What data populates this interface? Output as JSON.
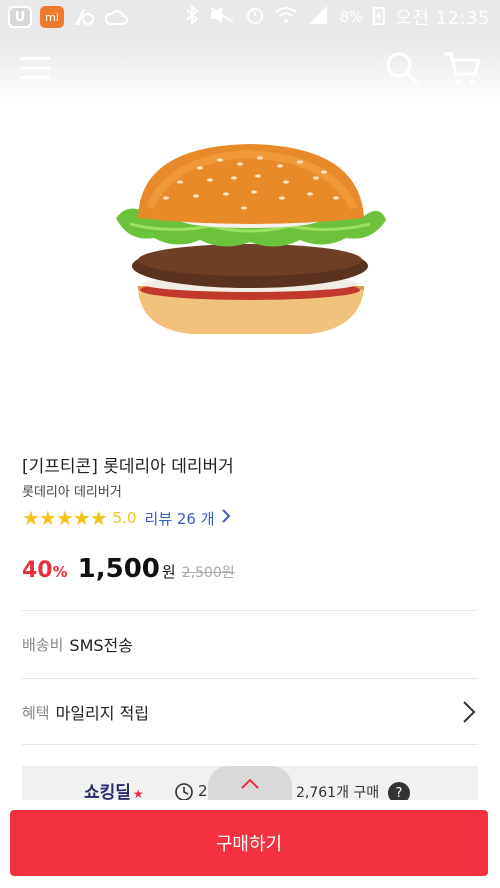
{
  "status_bar": {
    "app_icons": [
      "u-plus-app-icon",
      "mi-app-icon",
      "signal-app-icon",
      "cloud-icon"
    ],
    "battery_percent": "8%",
    "time": "오전 12:35"
  },
  "header": {
    "icons": [
      "menu-icon",
      "search-icon",
      "cart-icon"
    ]
  },
  "product": {
    "image_alt": "burger",
    "title": "[기프티콘] 롯데리아 데리버거",
    "brand": "롯데리아 데리버거",
    "rating_stars": 5,
    "rating_score": "5.0",
    "review_label": "리뷰 26 개",
    "discount_number": "40",
    "discount_sign": "%",
    "price": "1,500",
    "price_unit": "원",
    "original_price": "2,500원"
  },
  "shipping": {
    "label": "배송비",
    "value": "SMS전송"
  },
  "benefit": {
    "label": "혜택",
    "value": "마일리지 적립"
  },
  "deal": {
    "logo": "쇼킹딜",
    "timer": "2",
    "count": "2,761개 구매",
    "help": "?"
  },
  "buy_button": {
    "label": "구매하기"
  },
  "colors": {
    "accent": "#f4323f",
    "star": "#f3c21c",
    "link": "#3a5dc8"
  }
}
